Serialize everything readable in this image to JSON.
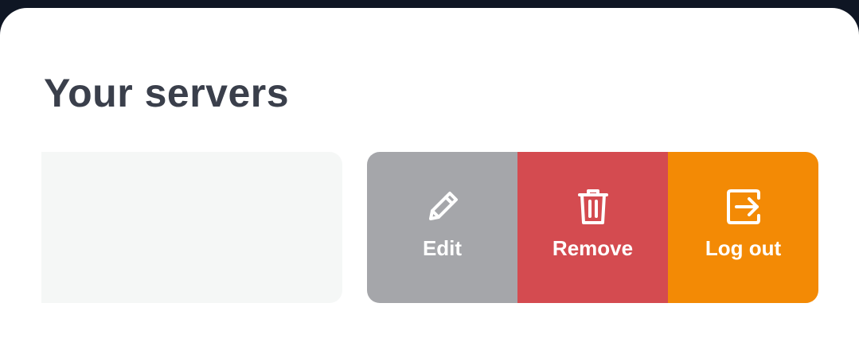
{
  "page": {
    "title": "Your servers"
  },
  "actions": [
    {
      "label": "Edit",
      "icon": "pencil-icon",
      "color": "#a5a6aa"
    },
    {
      "label": "Remove",
      "icon": "trash-icon",
      "color": "#d44b50"
    },
    {
      "label": "Log out",
      "icon": "logout-icon",
      "color": "#f38a05"
    }
  ]
}
